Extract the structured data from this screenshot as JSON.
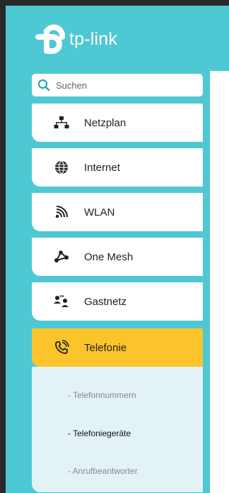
{
  "brand": {
    "name": "tp-link"
  },
  "search": {
    "placeholder": "Suchen"
  },
  "menu": {
    "items": [
      {
        "label": "Netzplan",
        "icon": "network-icon"
      },
      {
        "label": "Internet",
        "icon": "globe-icon"
      },
      {
        "label": "WLAN",
        "icon": "wifi-icon"
      },
      {
        "label": "One Mesh",
        "icon": "mesh-icon"
      },
      {
        "label": "Gastnetz",
        "icon": "guest-network-icon"
      },
      {
        "label": "Telefonie",
        "icon": "phone-icon",
        "active": true
      }
    ],
    "submenu": [
      {
        "label": "- Telefonnummern"
      },
      {
        "label": "- Telefoniegeräte",
        "selected": true
      },
      {
        "label": "- Anrufbeantworter"
      }
    ]
  },
  "colors": {
    "sidebar": "#4ec8d3",
    "active": "#fbc42b",
    "submenu_bg": "#e3f3f5"
  }
}
